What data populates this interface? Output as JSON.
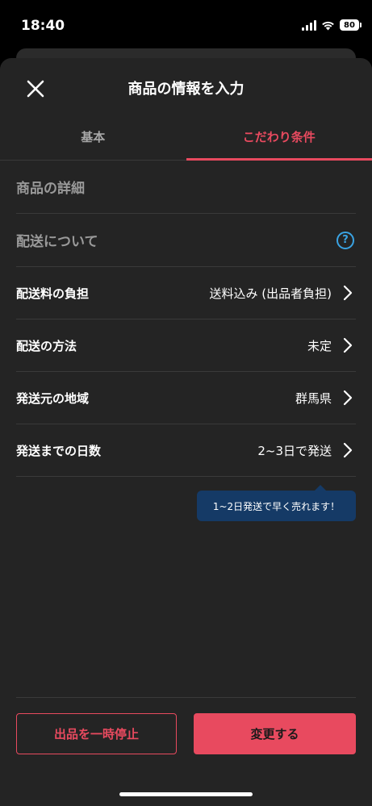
{
  "status_bar": {
    "time": "18:40",
    "battery": "80"
  },
  "header": {
    "title": "商品の情報を入力",
    "close_icon": "close-icon"
  },
  "tabs": [
    {
      "label": "基本",
      "active": false
    },
    {
      "label": "こだわり条件",
      "active": true
    }
  ],
  "sections": {
    "product_detail": "商品の詳細",
    "shipping": "配送について"
  },
  "settings": [
    {
      "label": "配送料の負担",
      "value": "送料込み (出品者負担)"
    },
    {
      "label": "配送の方法",
      "value": "未定"
    },
    {
      "label": "発送元の地域",
      "value": "群馬県"
    },
    {
      "label": "発送までの日数",
      "value": "2~3日で発送"
    }
  ],
  "tooltip": "1~2日発送で早く売れます！",
  "buttons": {
    "pause": "出品を一時停止",
    "change": "変更する"
  },
  "colors": {
    "accent": "#e84a5f",
    "help": "#3aa3e3",
    "tooltip_bg": "#153a66"
  }
}
